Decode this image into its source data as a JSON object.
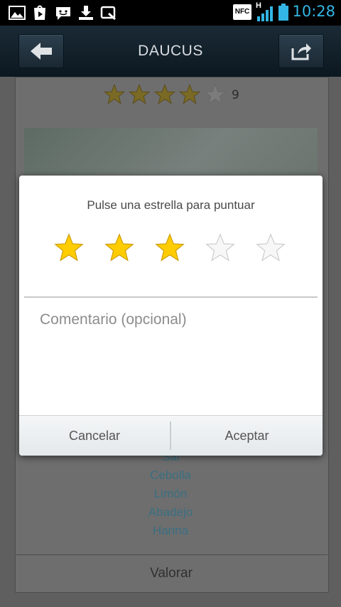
{
  "status_bar": {
    "time": "10:28",
    "nfc_label": "NFC",
    "network_label": "H",
    "icons": [
      "gallery-icon",
      "play-store-icon",
      "chat-icon",
      "download-icon",
      "screenshot-icon",
      "nfc-icon",
      "signal-icon",
      "battery-icon"
    ],
    "accent_color": "#33b5e5"
  },
  "action_bar": {
    "title": "DAUCUS",
    "back_icon": "back-arrow-icon",
    "share_icon": "share-icon"
  },
  "recipe": {
    "rating_value": 4,
    "rating_max": 5,
    "rating_count": "9",
    "ingredients": [
      "Sal",
      "Cebolla",
      "Limón",
      "Abadejo",
      "Harina"
    ],
    "valorar_label": "Valorar"
  },
  "dialog": {
    "title": "Pulse una estrella para puntuar",
    "selected_stars": 3,
    "max_stars": 5,
    "comment_placeholder": "Comentario (opcional)",
    "cancel_label": "Cancelar",
    "accept_label": "Aceptar"
  },
  "colors": {
    "star_filled": "#ffcc00",
    "link_text": "#3a6f82"
  }
}
